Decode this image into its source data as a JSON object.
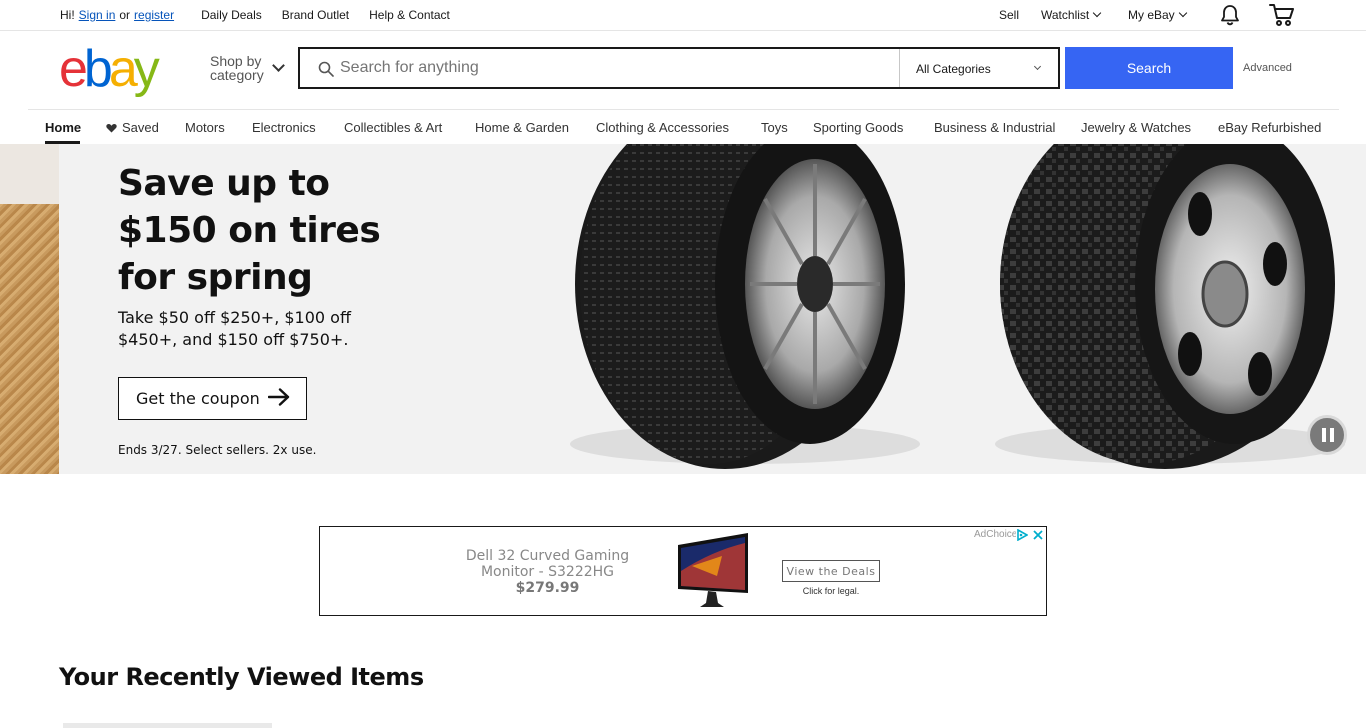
{
  "topbar": {
    "greeting": "Hi!",
    "sign_in": "Sign in",
    "or": "or",
    "register": "register",
    "links": [
      "Daily Deals",
      "Brand Outlet",
      "Help & Contact"
    ],
    "sell": "Sell",
    "watchlist": "Watchlist",
    "my_ebay": "My eBay",
    "icons": [
      "bell-icon",
      "cart-icon"
    ]
  },
  "header": {
    "logo": {
      "e": "e",
      "b": "b",
      "a": "a",
      "y": "y"
    },
    "shop_by_category": [
      "Shop by",
      "category"
    ],
    "search_placeholder": "Search for anything",
    "category_select": "All Categories",
    "search_button": "Search",
    "advanced": "Advanced"
  },
  "catnav": {
    "items": [
      "Home",
      "Saved",
      "Motors",
      "Electronics",
      "Collectibles & Art",
      "Home & Garden",
      "Clothing & Accessories",
      "Toys",
      "Sporting Goods",
      "Business & Industrial",
      "Jewelry & Watches",
      "eBay Refurbished"
    ]
  },
  "hero": {
    "headline": "Save up to $150 on tires for spring",
    "subtext": "Take $50 off $250+, $100 off $450+, and $150 off $750+.",
    "cta": "Get the coupon",
    "fineprint": "Ends 3/27. Select sellers. 2x use."
  },
  "ad": {
    "title": "Dell 32 Curved Gaming Monitor - S3222HG",
    "price": "$279.99",
    "cta": "View the Deals",
    "legal": "Click for legal.",
    "adchoices": "AdChoices"
  },
  "sections": {
    "recently_viewed": "Your Recently Viewed Items"
  },
  "colors": {
    "search_blue": "#3665f3",
    "link_blue": "#0654ba",
    "logo_red": "#e53238",
    "logo_blue": "#0064d2",
    "logo_yellow": "#f5af02",
    "logo_green": "#86b817"
  }
}
